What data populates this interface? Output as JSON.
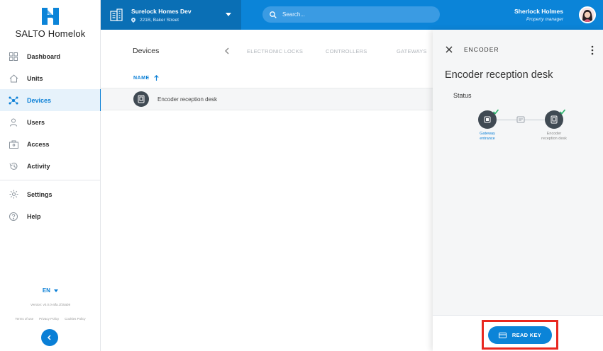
{
  "brand": {
    "name": "SALTO Homelok",
    "color": "#0b84d8"
  },
  "sidebar": {
    "items": [
      {
        "label": "Dashboard",
        "icon": "dashboard-icon",
        "active": false
      },
      {
        "label": "Units",
        "icon": "home-icon",
        "active": false
      },
      {
        "label": "Devices",
        "icon": "devices-icon",
        "active": true
      },
      {
        "label": "Users",
        "icon": "user-icon",
        "active": false
      },
      {
        "label": "Access",
        "icon": "access-icon",
        "active": false
      },
      {
        "label": "Activity",
        "icon": "history-icon",
        "active": false
      }
    ],
    "secondary": [
      {
        "label": "Settings",
        "icon": "gear-icon"
      },
      {
        "label": "Help",
        "icon": "help-icon"
      }
    ],
    "language": "EN",
    "version": "Version: v0.0.0-alfa.1f25ab9",
    "legal": [
      "Terms of use",
      "Privacy Policy",
      "Cookies Policy"
    ]
  },
  "header": {
    "site_name": "Surelock Homes Dev",
    "site_address": "221B, Baker Street",
    "search_placeholder": "Search...",
    "user_name": "Sherlock Holmes",
    "user_role": "Property manager"
  },
  "main": {
    "title": "Devices",
    "tabs": [
      "ELECTRONIC LOCKS",
      "CONTROLLERS",
      "GATEWAYS"
    ],
    "column_header": "NAME",
    "rows": [
      {
        "label": "Encoder reception desk"
      }
    ]
  },
  "panel": {
    "title": "ENCODER",
    "device_name": "Encoder reception desk",
    "status_label": "Status",
    "flow": {
      "left_label_1": "Gateway",
      "left_label_2": "entrance",
      "right_label_1": "Encoder",
      "right_label_2": "reception desk"
    },
    "action_label": "READ KEY"
  }
}
